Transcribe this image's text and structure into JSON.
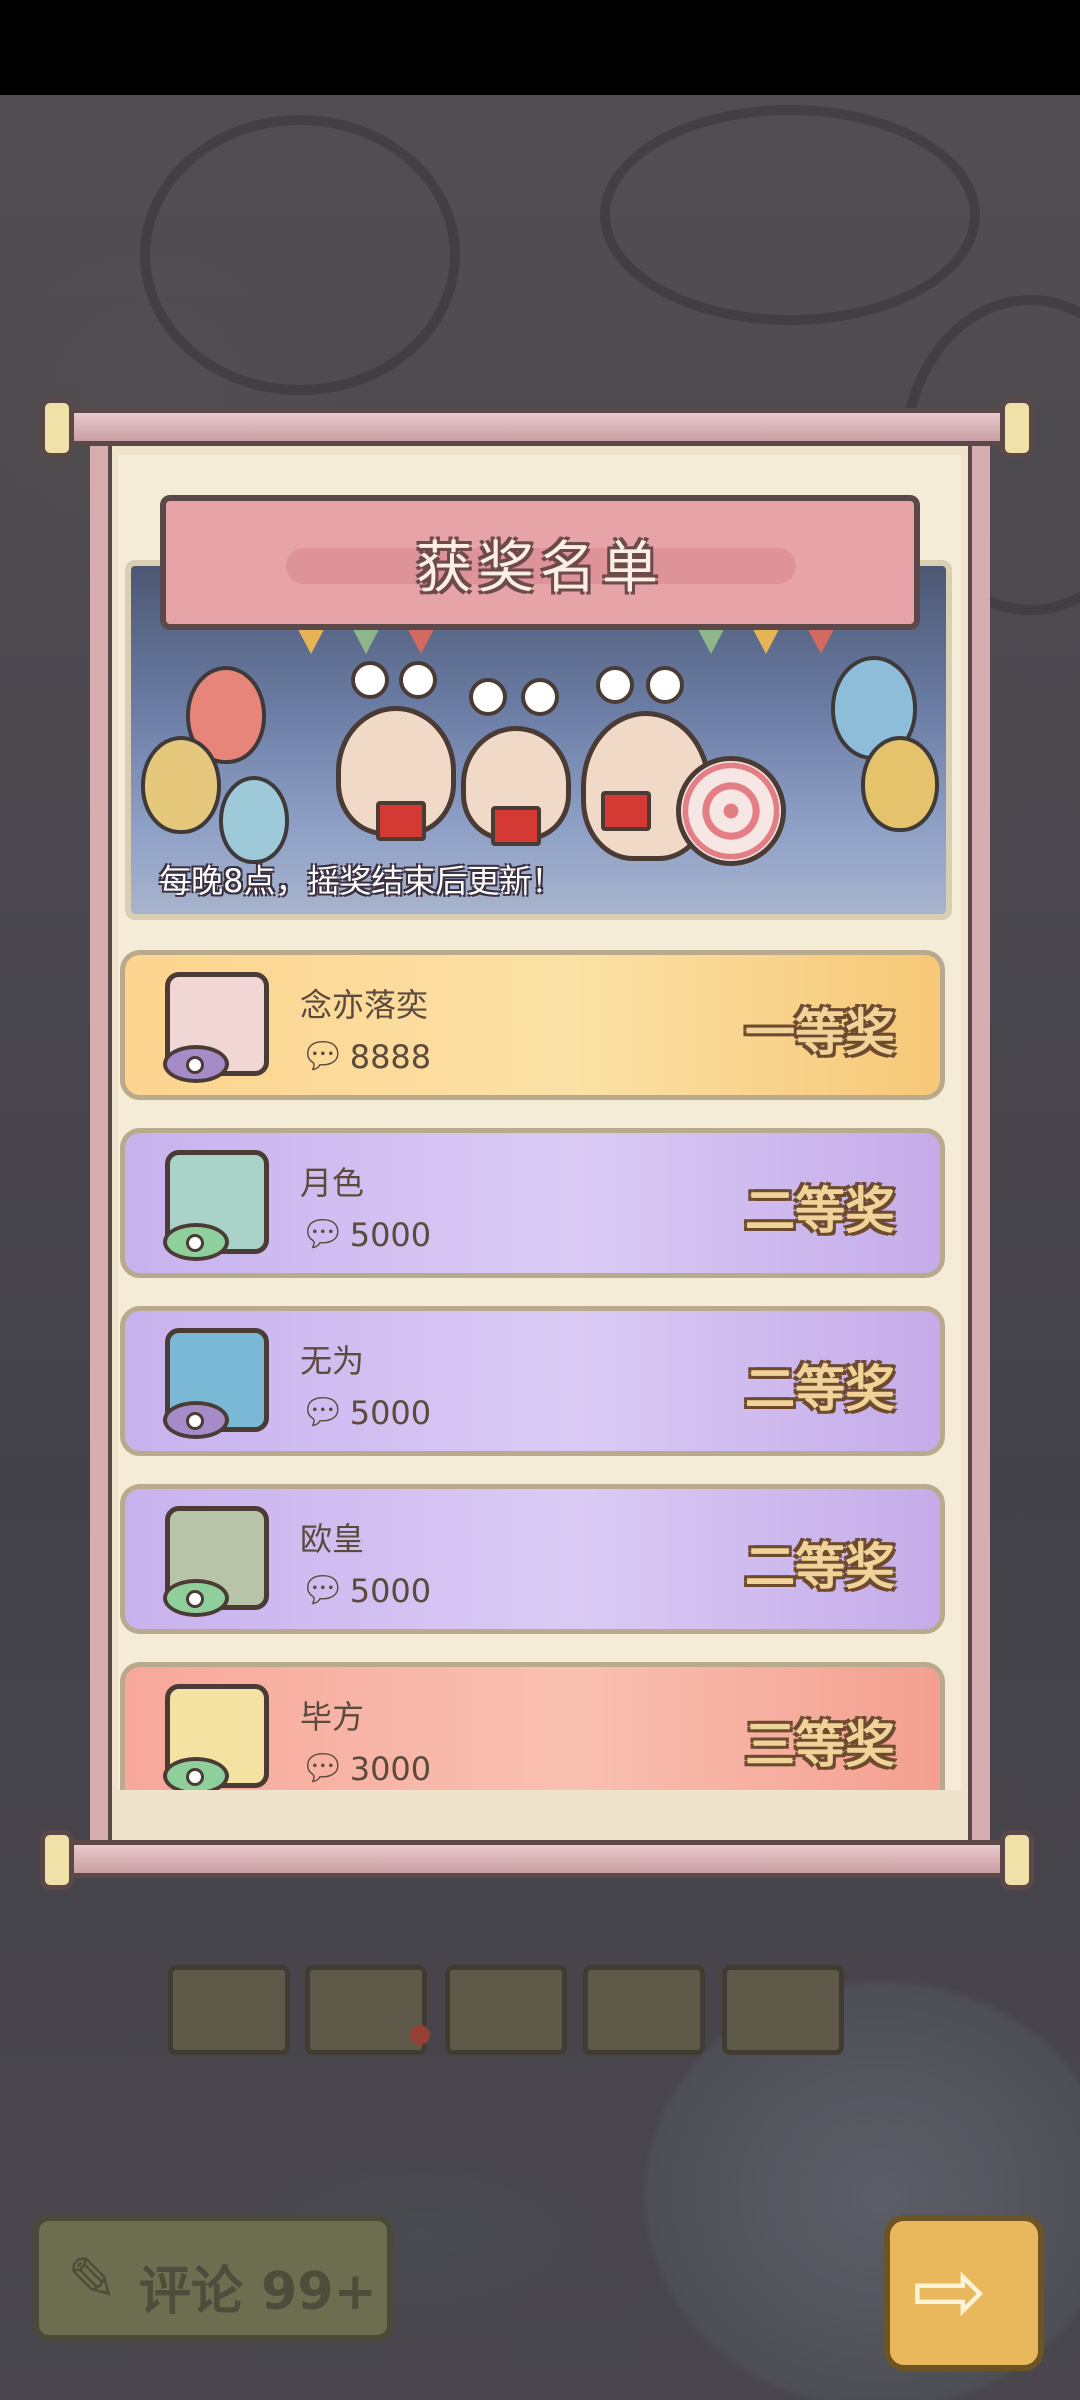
{
  "dialog": {
    "title": "获奖名单",
    "banner_note": "每晚8点，摇奖结束后更新！"
  },
  "winners": [
    {
      "name": "念亦落奕",
      "votes": "8888",
      "prize": "一等奖",
      "tier": "first"
    },
    {
      "name": "月色",
      "votes": "5000",
      "prize": "二等奖",
      "tier": "second"
    },
    {
      "name": "无为",
      "votes": "5000",
      "prize": "二等奖",
      "tier": "second"
    },
    {
      "name": "欧皇",
      "votes": "5000",
      "prize": "二等奖",
      "tier": "second"
    },
    {
      "name": "毕方",
      "votes": "3000",
      "prize": "三等奖",
      "tier": "third"
    }
  ],
  "bottom": {
    "comment_label": "评论 99+"
  },
  "icons": {
    "vote": "speech-bubble-icon",
    "comment": "quill-icon",
    "next": "arrow-right-icon"
  },
  "colors": {
    "first_prize_row": "#fbdc9c",
    "second_prize_row": "#d4c2f2",
    "third_prize_row": "#f7b3a5",
    "title_plate": "#e6a4a8"
  }
}
